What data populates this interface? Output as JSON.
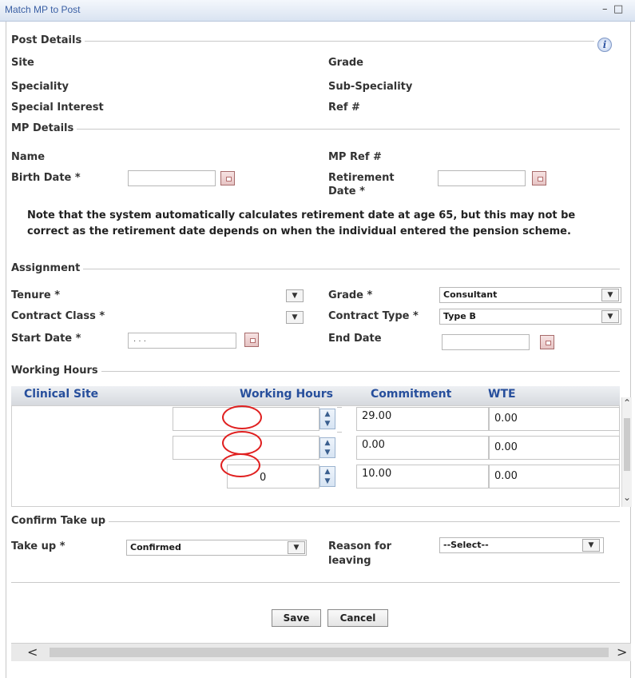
{
  "window": {
    "title": "Match MP to Post",
    "minimize_glyph": "–",
    "maximize_glyph": "□"
  },
  "info_icon_glyph": "i",
  "post_details": {
    "section_label": "Post Details",
    "site_label": "Site",
    "grade_label": "Grade",
    "speciality_label": "Speciality",
    "sub_speciality_label": "Sub-Speciality",
    "special_interest_label": "Special Interest",
    "ref_label": "Ref #"
  },
  "mp_details": {
    "section_label": "MP Details",
    "name_label": "Name",
    "mp_ref_label": "MP Ref #",
    "birth_date_label": "Birth Date *",
    "birth_date_value": "",
    "retirement_label_line1": "Retirement",
    "retirement_label_line2": "Date *",
    "retirement_date_value": "",
    "note_line1": "Note that the system automatically calculates retirement date at age 65, but this may not be",
    "note_line2": "correct as the retirement date depends on when the individual entered the pension scheme."
  },
  "assignment": {
    "section_label": "Assignment",
    "tenure_label": "Tenure *",
    "tenure_value": "",
    "grade_label": "Grade *",
    "grade_value": "Consultant",
    "contract_class_label": "Contract Class *",
    "contract_class_value": "",
    "contract_type_label": "Contract Type *",
    "contract_type_value": "Type B",
    "start_date_label": "Start Date *",
    "start_date_value": ". . .",
    "end_date_label": "End Date",
    "end_date_value": ""
  },
  "working_hours": {
    "section_label": "Working Hours",
    "columns": [
      "Clinical Site",
      "Working Hours",
      "Commitment",
      "WTE"
    ],
    "rows": [
      {
        "hours": "",
        "commitment": "29.00",
        "wte": "0.00"
      },
      {
        "hours": "",
        "commitment": "0.00",
        "wte": "0.00"
      },
      {
        "hours": "0",
        "commitment": "10.00",
        "wte": "0.00"
      }
    ]
  },
  "confirm": {
    "section_label": "Confirm Take up",
    "take_up_label": "Take up *",
    "take_up_value": "Confirmed",
    "reason_label_line1": "Reason for",
    "reason_label_line2": "leaving",
    "reason_value": "--Select--"
  },
  "buttons": {
    "save": "Save",
    "cancel": "Cancel"
  },
  "icons": {
    "dropdown": "chevron-down-icon",
    "calendar": "calendar-icon",
    "spinner": "spinner-icon",
    "scroll_left": "chevron-left-icon",
    "scroll_right": "chevron-right-icon",
    "info": "info-icon"
  },
  "colors": {
    "title_text": "#3a5fa4",
    "grid_header_text": "#274f9c",
    "highlight_oval": "#e02020"
  }
}
